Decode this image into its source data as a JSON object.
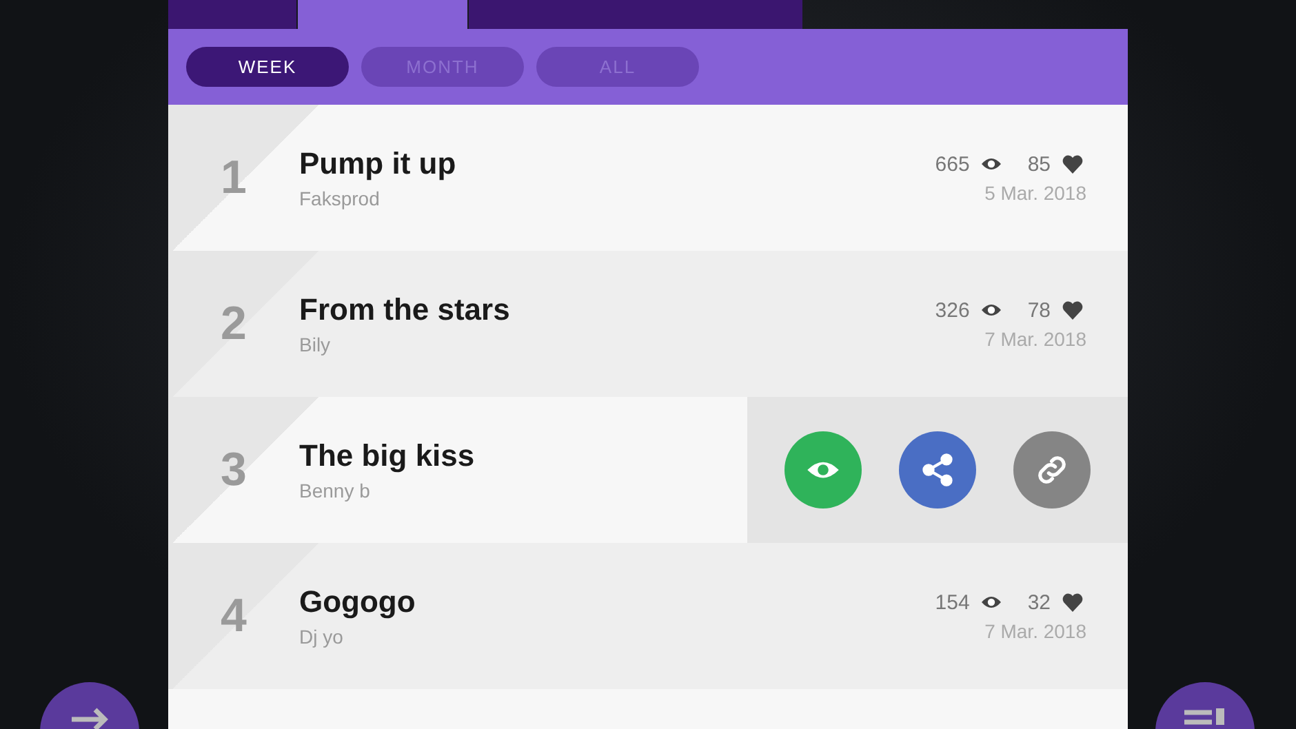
{
  "top_tabs": [
    {
      "selected": false
    },
    {
      "selected": true
    },
    {
      "selected": false
    }
  ],
  "filters": [
    {
      "label": "WEEK",
      "selected": true
    },
    {
      "label": "MONTH",
      "selected": false
    },
    {
      "label": "ALL",
      "selected": false
    }
  ],
  "tracks": [
    {
      "kind": "stats",
      "rank": "1",
      "title": "Pump it up",
      "artist": "Faksprod",
      "views": "665",
      "likes": "85",
      "date": "5 Mar. 2018"
    },
    {
      "kind": "stats",
      "rank": "2",
      "title": "From the stars",
      "artist": "Bily",
      "views": "326",
      "likes": "78",
      "date": "7 Mar. 2018"
    },
    {
      "kind": "actions",
      "rank": "3",
      "title": "The big kiss",
      "artist": "Benny b"
    },
    {
      "kind": "stats",
      "rank": "4",
      "title": "Gogogo",
      "artist": "Dj yo",
      "views": "154",
      "likes": "32",
      "date": "7 Mar. 2018"
    }
  ]
}
